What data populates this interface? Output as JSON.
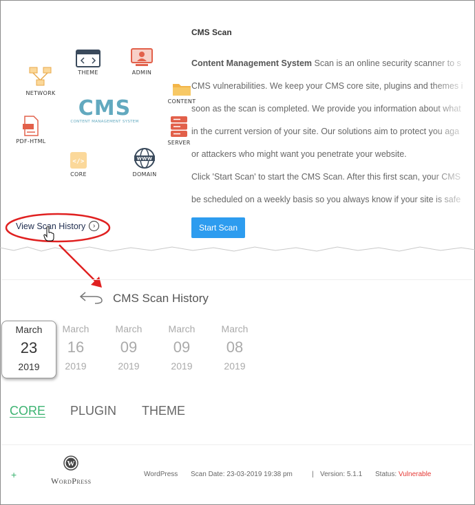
{
  "scan_card": {
    "diagram": {
      "logo_text": "CMS",
      "logo_subtext": "CONTENT MANAGEMENT SYSTEM",
      "nodes": [
        {
          "label": "THEME",
          "icon": "theme-icon"
        },
        {
          "label": "ADMIN",
          "icon": "admin-icon"
        },
        {
          "label": "NETWORK",
          "icon": "network-icon"
        },
        {
          "label": "CONTENT",
          "icon": "folder-icon"
        },
        {
          "label": "PDF-HTML",
          "icon": "pdf-file-icon"
        },
        {
          "label": "SERVER",
          "icon": "server-icon"
        },
        {
          "label": "CORE",
          "icon": "code-icon"
        },
        {
          "label": "DOMAIN",
          "icon": "globe-www-icon"
        }
      ]
    },
    "view_history_label": "View Scan History",
    "title": "CMS Scan",
    "lines": {
      "l1_bold": "Content Management System",
      "l1_rest": " Scan is an online security scanner to s",
      "l2": "CMS vulnerabilities. We keep your CMS core site, plugins and themes i",
      "l3": "soon as the scan is completed. We provide you information about what",
      "l4": "in the current version of your site. Our solutions aim to protect you aga",
      "l5": "or attackers who might want you penetrate your website.",
      "l6": "Click 'Start Scan' to start the CMS Scan. After this first scan, your CMS",
      "l7": "be scheduled on a weekly basis so you always know if your site is safe"
    },
    "start_button": "Start Scan"
  },
  "history": {
    "title": "CMS Scan History",
    "dates": [
      {
        "month": "March",
        "day": "23",
        "year": "2019",
        "active": true
      },
      {
        "month": "March",
        "day": "16",
        "year": "2019",
        "active": false
      },
      {
        "month": "March",
        "day": "09",
        "year": "2019",
        "active": false
      },
      {
        "month": "March",
        "day": "09",
        "year": "2019",
        "active": false
      },
      {
        "month": "March",
        "day": "08",
        "year": "2019",
        "active": false
      }
    ],
    "tabs": [
      {
        "label": "CORE",
        "active": true
      },
      {
        "label": "PLUGIN",
        "active": false
      },
      {
        "label": "THEME",
        "active": false
      }
    ],
    "row": {
      "expand": "+",
      "logo_text": "WordPress",
      "name": "WordPress",
      "scan_date": "Scan Date: 23-03-2019 19:38 pm",
      "separator": "|",
      "version": "Version: 5.1.1",
      "status_label": "Status:",
      "status_value": "Vulnerable"
    }
  },
  "colors": {
    "accent_blue": "#2d9cef",
    "tab_active_green": "#3cb371",
    "vulnerable_red": "#e53935",
    "annotation_red": "#e02020",
    "cms_logo_teal": "#62a9bf"
  }
}
